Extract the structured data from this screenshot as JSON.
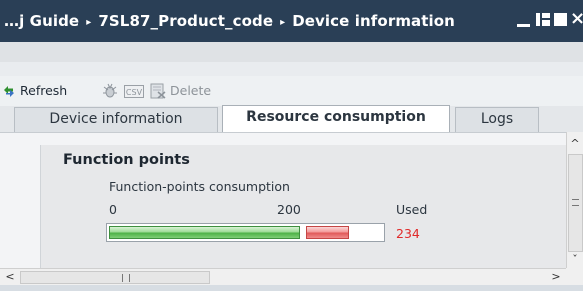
{
  "titlebar": {
    "breadcrumb": [
      "…j Guide",
      "7SL87_Product_code",
      "Device information"
    ],
    "separator": "▸",
    "close_glyph": "×"
  },
  "toolbar": {
    "refresh_label": "Refresh",
    "refresh_icon": "refresh-icon",
    "bug_icon": "bug-icon",
    "csv_icon": "csv-export-icon",
    "delete_label": "Delete",
    "delete_icon": "delete-icon"
  },
  "tabs": [
    {
      "label": "Device information",
      "active": false
    },
    {
      "label": "Resource consumption",
      "active": true
    },
    {
      "label": "Logs",
      "active": false
    }
  ],
  "section": {
    "title": "Function points",
    "metric_label": "Function-points consumption",
    "tick_min": "0",
    "tick_mid": "200",
    "used_label": "Used",
    "used_value": "234",
    "capacity_value": 200,
    "used_number": 234,
    "scale_max": 280
  },
  "colors": {
    "titlebar_bg": "#2a3f56",
    "ok_green": "#4eb247",
    "over_red": "#e02a2a"
  },
  "scroll": {
    "up_arrow": "^",
    "down_arrow": "ˇ",
    "left_arrow": "<",
    "right_arrow": ">"
  }
}
